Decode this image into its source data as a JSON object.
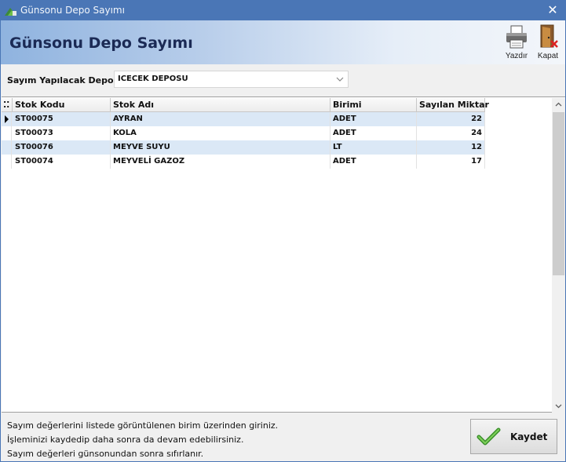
{
  "window": {
    "title": "Günsonu Depo Sayımı"
  },
  "banner": {
    "heading": "Günsonu Depo Sayımı"
  },
  "toolbar": {
    "print_label": "Yazdır",
    "close_label": "Kapat"
  },
  "depot": {
    "label": "Sayım Yapılacak Depo",
    "value": "ICECEK DEPOSU"
  },
  "grid": {
    "columns": [
      "Stok Kodu",
      "Stok Adı",
      "Birimi",
      "Sayılan Miktar"
    ],
    "rows": [
      {
        "code": "ST00075",
        "name": "AYRAN",
        "unit": "ADET",
        "qty": "22"
      },
      {
        "code": "ST00073",
        "name": "KOLA",
        "unit": "ADET",
        "qty": "24"
      },
      {
        "code": "ST00076",
        "name": "MEYVE SUYU",
        "unit": "LT",
        "qty": "12"
      },
      {
        "code": "ST00074",
        "name": "MEYVELİ GAZOZ",
        "unit": "ADET",
        "qty": "17"
      }
    ]
  },
  "footer": {
    "lines": [
      "Sayım değerlerini listede görüntülenen birim üzerinden giriniz.",
      "İşleminizi kaydedip daha sonra da devam edebilirsiniz.",
      "Sayım değerleri günsonundan sonra sıfırlanır."
    ],
    "save_label": "Kaydet"
  },
  "icons": {
    "app": "app-logo-icon",
    "close": "close-icon",
    "print": "printer-icon",
    "exit": "exit-door-icon",
    "dropdown": "chevron-down-icon",
    "row_pointer": "row-pointer-icon",
    "save": "checkmark-icon"
  },
  "colors": {
    "titlebar": "#4a76b6",
    "alt_row": "#dbe8f6",
    "heading": "#1b2a55"
  }
}
